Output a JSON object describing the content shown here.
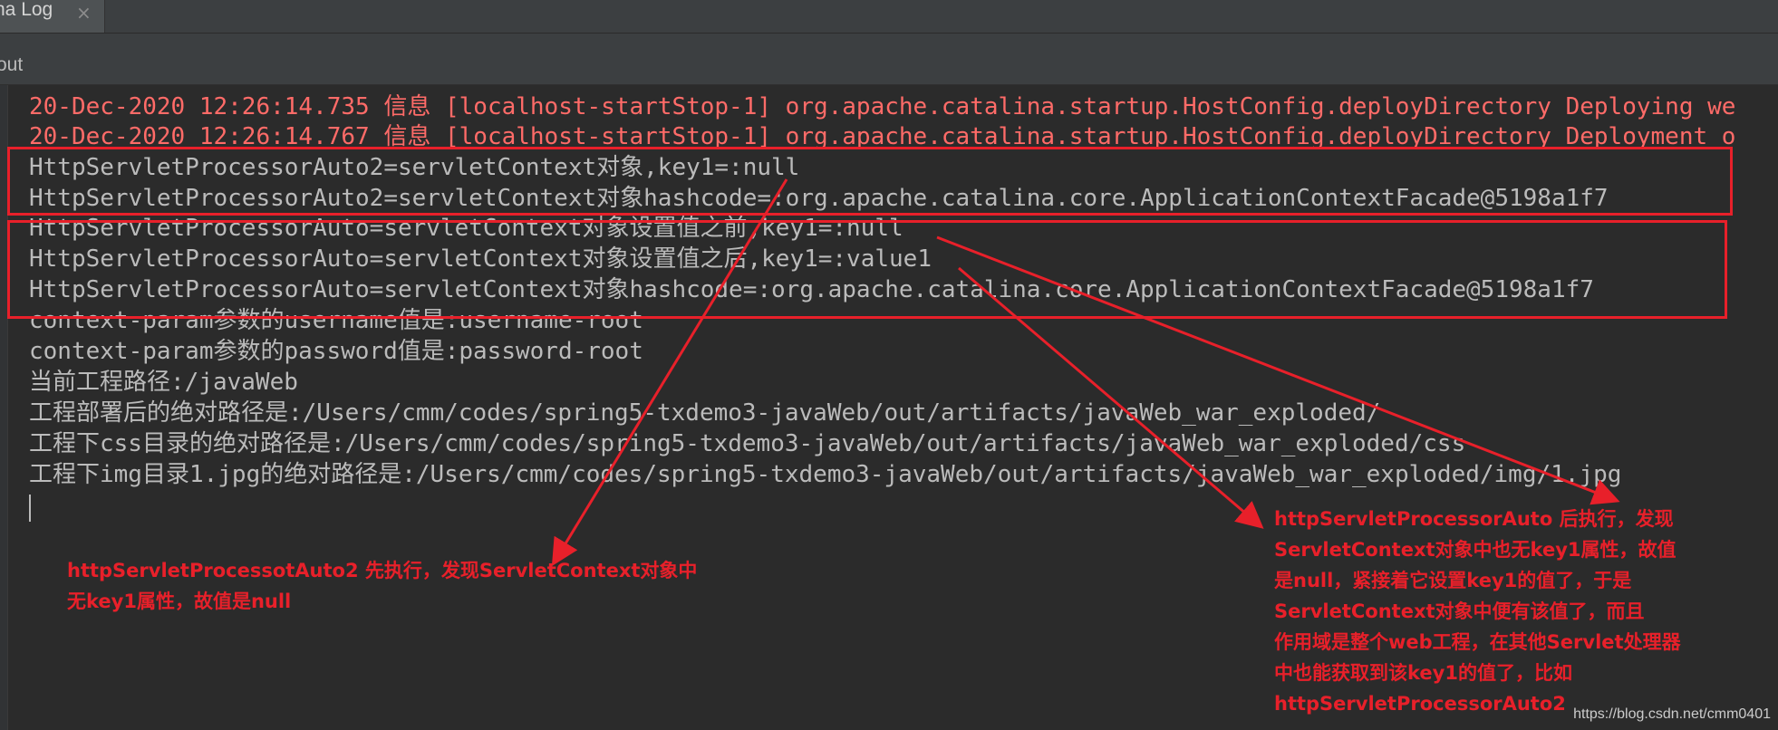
{
  "tab": {
    "label": "na Log",
    "close": "×"
  },
  "subbar": {
    "label": "out"
  },
  "console": {
    "lines": [
      "20-Dec-2020 12:26:14.735 信息 [localhost-startStop-1] org.apache.catalina.startup.HostConfig.deployDirectory Deploying we",
      "20-Dec-2020 12:26:14.767 信息 [localhost-startStop-1] org.apache.catalina.startup.HostConfig.deployDirectory Deployment o",
      "HttpServletProcessorAuto2=servletContext对象,key1=:null",
      "HttpServletProcessorAuto2=servletContext对象hashcode=:org.apache.catalina.core.ApplicationContextFacade@5198a1f7",
      "HttpServletProcessorAuto=servletContext对象设置值之前,key1=:null",
      "HttpServletProcessorAuto=servletContext对象设置值之后,key1=:value1",
      "HttpServletProcessorAuto=servletContext对象hashcode=:org.apache.catalina.core.ApplicationContextFacade@5198a1f7",
      "context-param参数的username值是:username-root",
      "context-param参数的password值是:password-root",
      "当前工程路径:/javaWeb",
      "工程部署后的绝对路径是:/Users/cmm/codes/spring5-txdemo3-javaWeb/out/artifacts/javaWeb_war_exploded/",
      "工程下css目录的绝对路径是:/Users/cmm/codes/spring5-txdemo3-javaWeb/out/artifacts/javaWeb_war_exploded/css",
      "工程下img目录1.jpg的绝对路径是:/Users/cmm/codes/spring5-txdemo3-javaWeb/out/artifacts/javaWeb_war_exploded/img/1.jpg"
    ]
  },
  "annotations": {
    "left": "httpServletProcessotAuto2 先执行，发现ServletContext对象中\n无key1属性，故值是null",
    "right": "httpServletProcessorAuto 后执行，发现\nServletContext对象中也无key1属性，故值\n是null，紧接着它设置key1的值了，于是\nServletContext对象中便有该值了，而且\n作用域是整个web工程，在其他Servlet处理器\n中也能获取到该key1的值了，比如\nhttpServletProcessorAuto2"
  },
  "watermark": "https://blog.csdn.net/cmm0401",
  "colors": {
    "background": "#2b2b2b",
    "console_text": "#bbbbbb",
    "error_text": "#ff6b68",
    "annotation": "#e8202a"
  }
}
